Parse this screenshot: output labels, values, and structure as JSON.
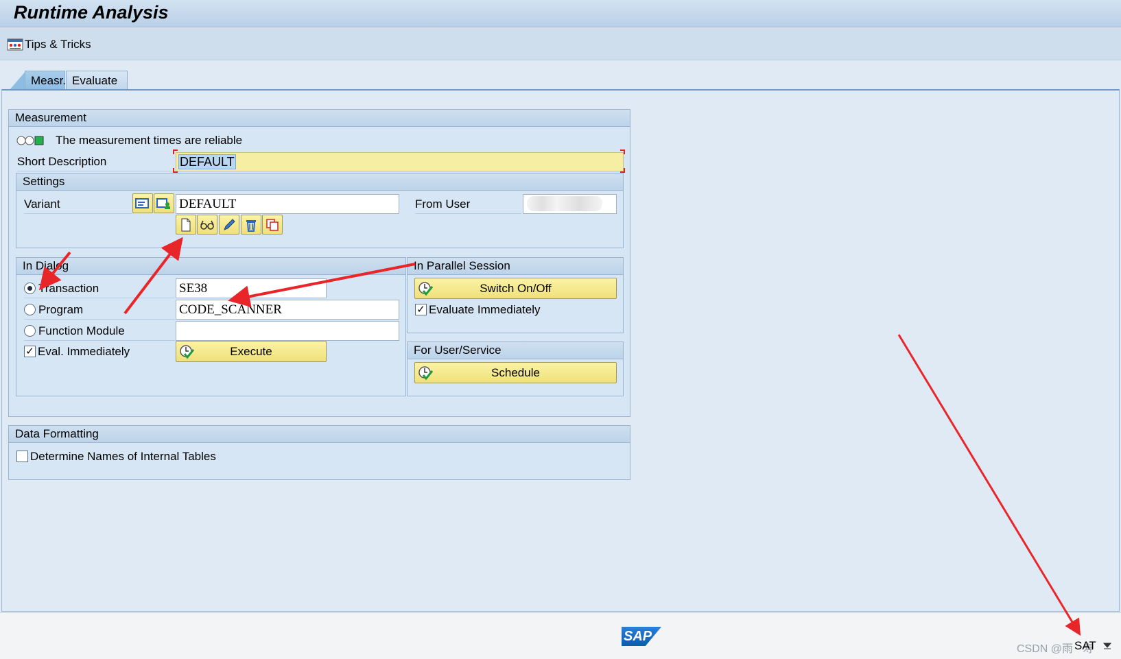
{
  "window": {
    "title": "Runtime Analysis"
  },
  "toolbar": {
    "tips_label": "Tips & Tricks",
    "tips_icon": "tips-icon"
  },
  "tabs": [
    {
      "label": "Measr.",
      "active": true
    },
    {
      "label": "Evaluate",
      "active": false
    }
  ],
  "measurement": {
    "heading": "Measurement",
    "status_text": "The measurement times are reliable",
    "status_color": "#22b14c",
    "short_desc_label": "Short Description",
    "short_desc_value": "DEFAULT"
  },
  "settings": {
    "heading": "Settings",
    "variant_label": "Variant",
    "variant_value": "DEFAULT",
    "from_user_label": "From User",
    "variant_buttons": [
      "create-variant-icon",
      "display-variant-icon",
      "edit-variant-icon",
      "delete-variant-icon",
      "copy-variant-icon"
    ]
  },
  "in_dialog": {
    "heading": "In Dialog",
    "transaction_label": "Transaction",
    "transaction_value": "SE38",
    "transaction_selected": true,
    "program_label": "Program",
    "program_value": "CODE_SCANNER",
    "function_module_label": "Function Module",
    "function_module_value": "",
    "eval_immediately_label": "Eval. Immediately",
    "eval_immediately_checked": true,
    "execute_label": "Execute"
  },
  "parallel_session": {
    "heading": "In Parallel Session",
    "switch_label": "Switch On/Off",
    "evaluate_immediately_label": "Evaluate Immediately",
    "evaluate_immediately_checked": true
  },
  "user_service": {
    "heading": "For User/Service",
    "schedule_label": "Schedule"
  },
  "data_formatting": {
    "heading": "Data Formatting",
    "determine_names_label": "Determine Names of Internal Tables",
    "determine_names_checked": false
  },
  "statusbar": {
    "logo_text": "SAP",
    "watermark": "CSDN @雨 · 寿",
    "system_name": "SAT",
    "accent": "#0a5cb0"
  },
  "annotation_color": "#e8262a"
}
